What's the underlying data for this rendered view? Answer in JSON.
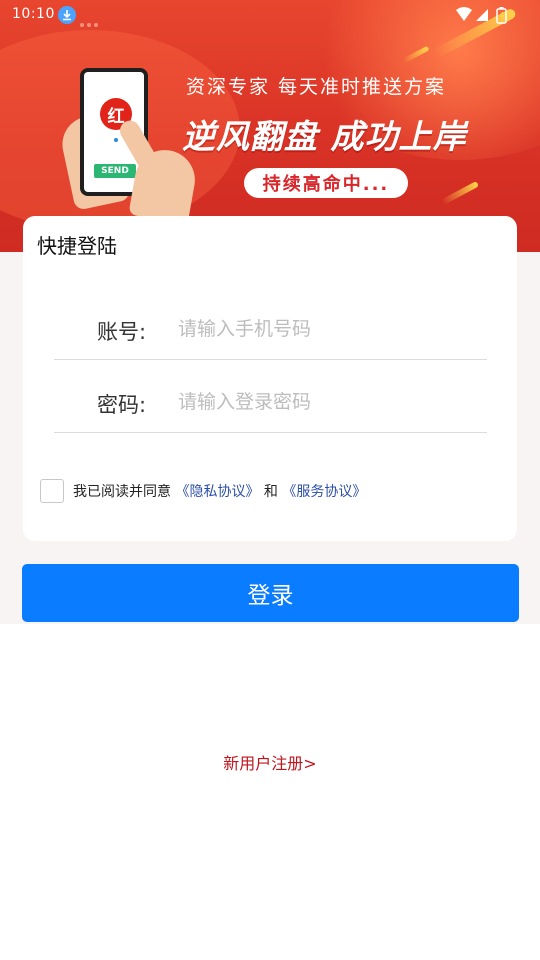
{
  "status_bar": {
    "time": "10:10"
  },
  "banner": {
    "subtitle": "资深专家 每天准时推送方案",
    "headline": "逆风翻盘 成功上岸",
    "pill": "持续高命中...",
    "phone_badge": "红",
    "phone_send": "SEND"
  },
  "login": {
    "title": "快捷登陆",
    "account_label": "账号:",
    "account_placeholder": "请输入手机号码",
    "password_label": "密码:",
    "password_placeholder": "请输入登录密码",
    "agree_text": "我已阅读并同意",
    "privacy_link": "《隐私协议》",
    "and_text": "和",
    "service_link": "《服务协议》",
    "submit_label": "登录",
    "register_link": "新用户注册>"
  },
  "colors": {
    "banner_red": "#d93226",
    "primary_blue": "#0a7cff",
    "link_blue": "#2c4fa8",
    "register_red": "#c0141c"
  }
}
